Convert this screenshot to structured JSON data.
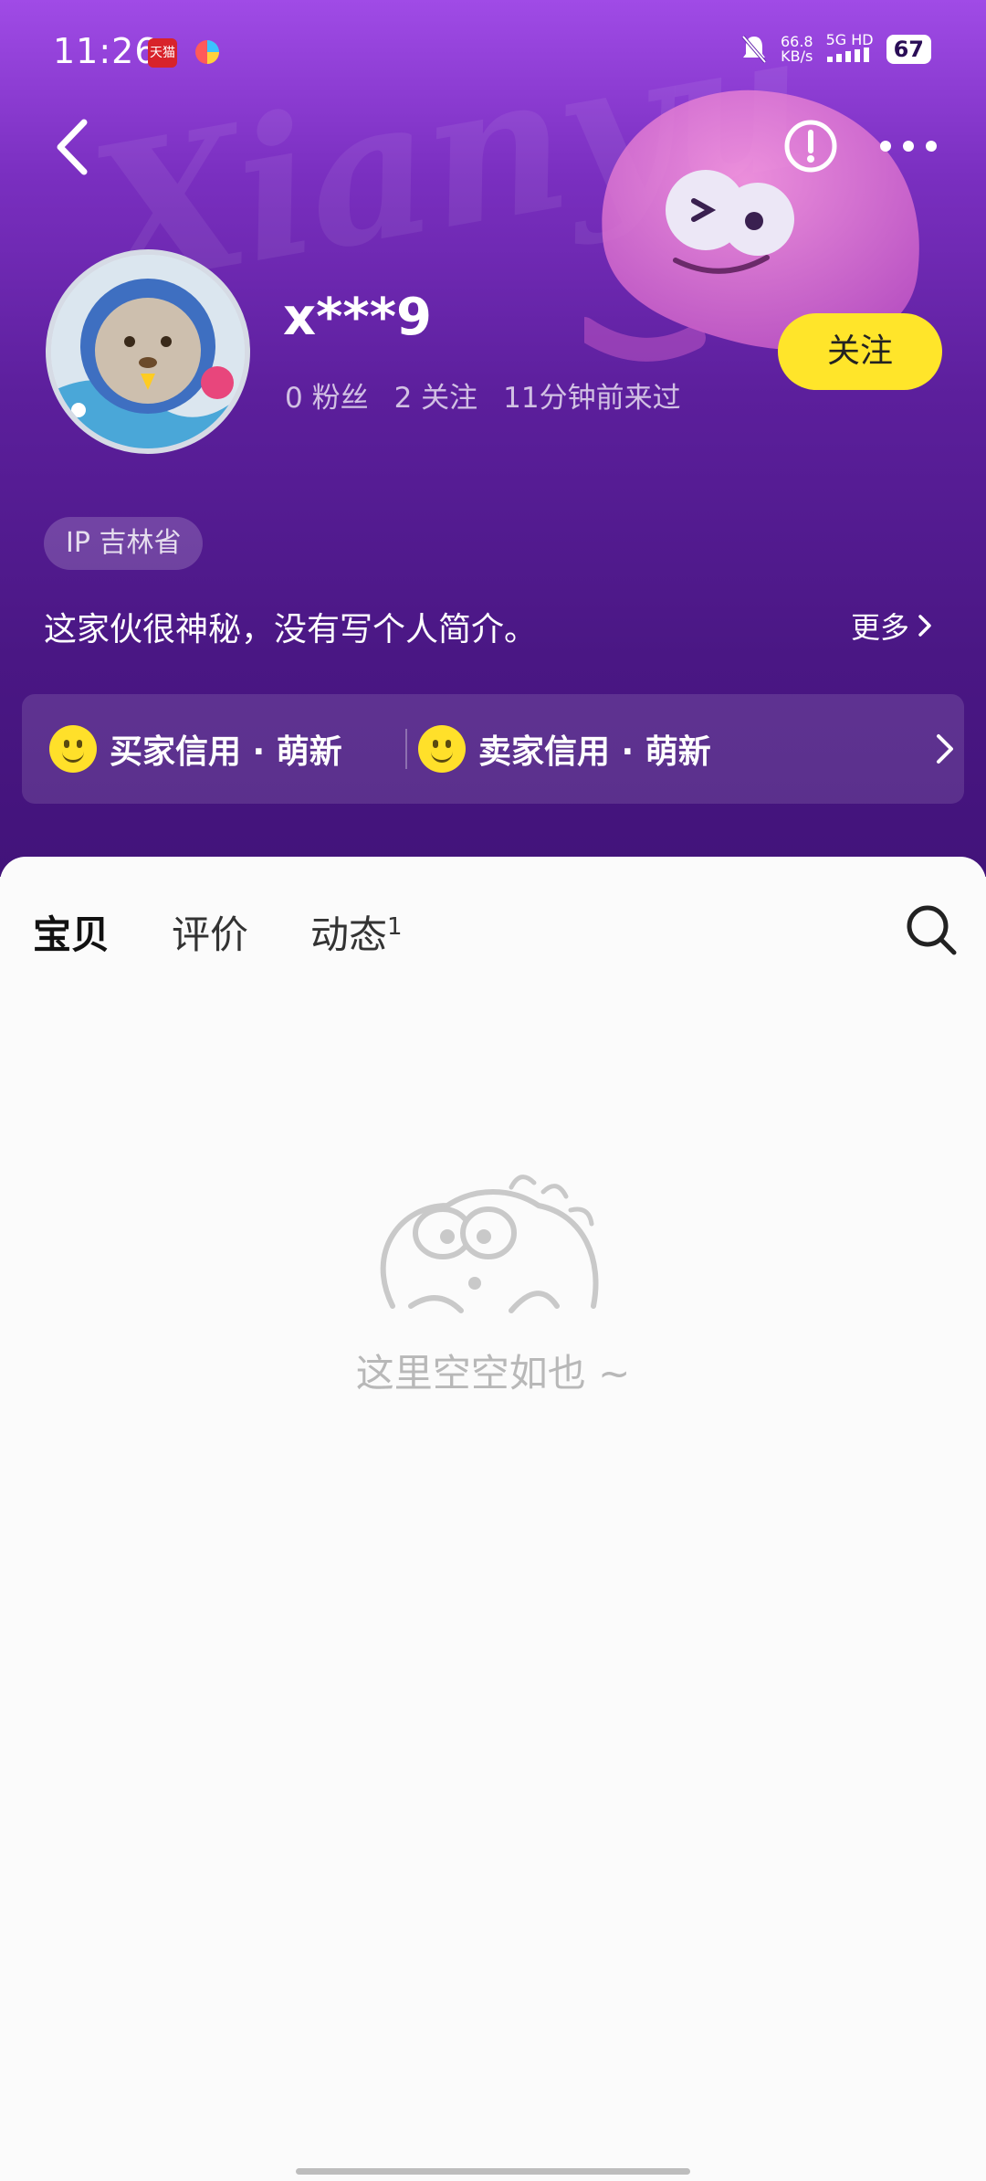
{
  "status_bar": {
    "time": "11:26",
    "app_badge_1": "天猫",
    "net_speed": "66.8",
    "net_unit": "KB/s",
    "signal": "5G HD",
    "battery": "67"
  },
  "profile": {
    "username": "x***9",
    "fans": "0 粉丝",
    "following": "2 关注",
    "last_seen": "11分钟前来过",
    "follow_label": "关注",
    "ip_label": "IP 吉林省",
    "bio": "这家伙很神秘，没有写个人简介。",
    "more_label": "更多"
  },
  "credit": {
    "buyer": "买家信用 · 萌新",
    "seller": "卖家信用 · 萌新"
  },
  "tabs": [
    {
      "label": "宝贝",
      "active": true
    },
    {
      "label": "评价",
      "active": false
    },
    {
      "label": "动态",
      "active": false,
      "badge": "1"
    }
  ],
  "empty_state": {
    "text": "这里空空如也 ~"
  },
  "colors": {
    "accent_yellow": "#ffe52a",
    "header_purple": "#5c1f9c"
  },
  "icons": [
    "back-icon",
    "report-icon",
    "more-icon",
    "search-icon",
    "chevron-right-icon",
    "smiley-icon"
  ]
}
